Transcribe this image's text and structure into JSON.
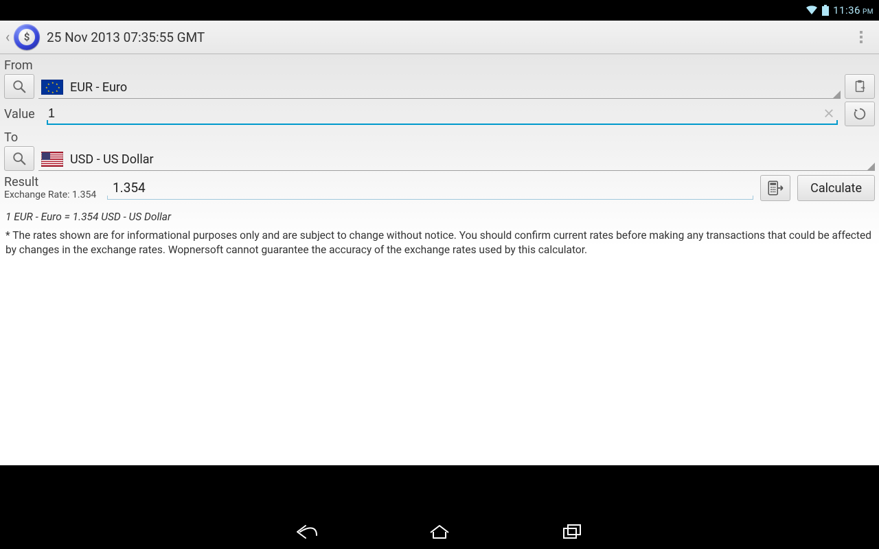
{
  "status": {
    "time": "11:36",
    "ampm": "PM"
  },
  "actionbar": {
    "title": "25 Nov 2013 07:35:55 GMT"
  },
  "from": {
    "label": "From",
    "currency_code": "EUR",
    "currency_name": "Euro",
    "spinner_text": "EUR - Euro"
  },
  "value": {
    "label": "Value",
    "input": "1"
  },
  "to": {
    "label": "To",
    "currency_code": "USD",
    "currency_name": "US Dollar",
    "spinner_text": "USD - US Dollar"
  },
  "result": {
    "label": "Result",
    "exchange_rate_label": "Exchange Rate: 1.354",
    "value": "1.354",
    "calculate_label": "Calculate"
  },
  "summary": "1 EUR - Euro = 1.354 USD - US Dollar",
  "disclaimer": "* The rates shown are for informational purposes only and are subject to change without notice. You should confirm current rates before making any transactions that could be affected by changes in the exchange rates. Wopnersoft cannot guarantee the accuracy of the exchange rates used by this calculator."
}
